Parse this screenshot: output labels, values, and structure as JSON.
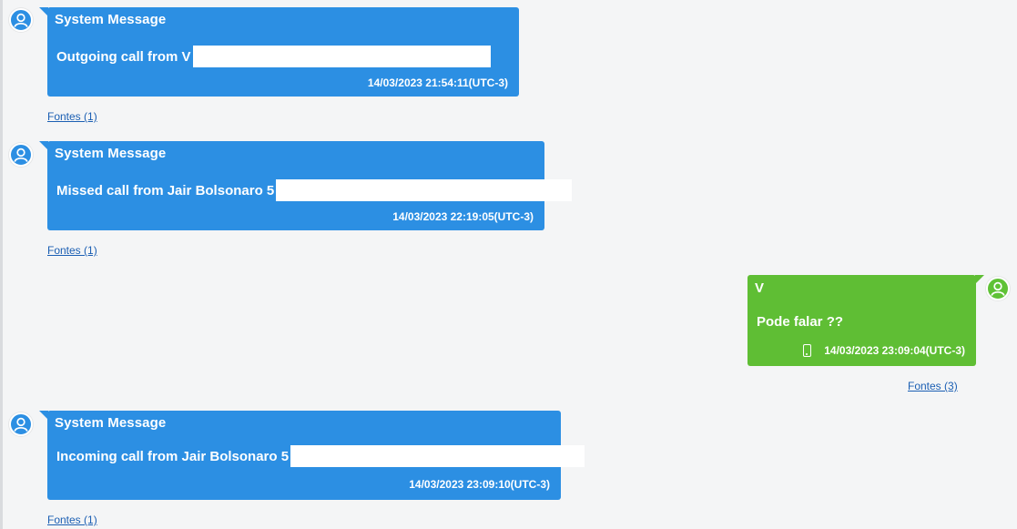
{
  "conversation": {
    "messages": [
      {
        "sender": "System Message",
        "text": "Outgoing call from V",
        "timestamp": "14/03/2023 21:54:11(UTC-3)",
        "sources": "Fontes (1)"
      },
      {
        "sender": "System Message",
        "text": "Missed call from Jair Bolsonaro 5",
        "timestamp": "14/03/2023 22:19:05(UTC-3)",
        "sources": "Fontes (1)"
      },
      {
        "sender": "V",
        "text": "Pode falar  ??",
        "timestamp": "14/03/2023 23:09:04(UTC-3)",
        "sources": "Fontes (3)"
      },
      {
        "sender": "System Message",
        "text": "Incoming call from Jair Bolsonaro 5",
        "timestamp": "14/03/2023 23:09:10(UTC-3)",
        "sources": "Fontes (1)"
      }
    ]
  },
  "colors": {
    "system_bubble": "#2c8fe3",
    "outgoing_bubble": "#5fbe34",
    "link": "#1b5fb3",
    "background": "#f4f5f6"
  },
  "icons": {
    "system_avatar": "user-avatar-icon",
    "sender_avatar": "user-avatar-icon",
    "device": "phone-icon"
  }
}
